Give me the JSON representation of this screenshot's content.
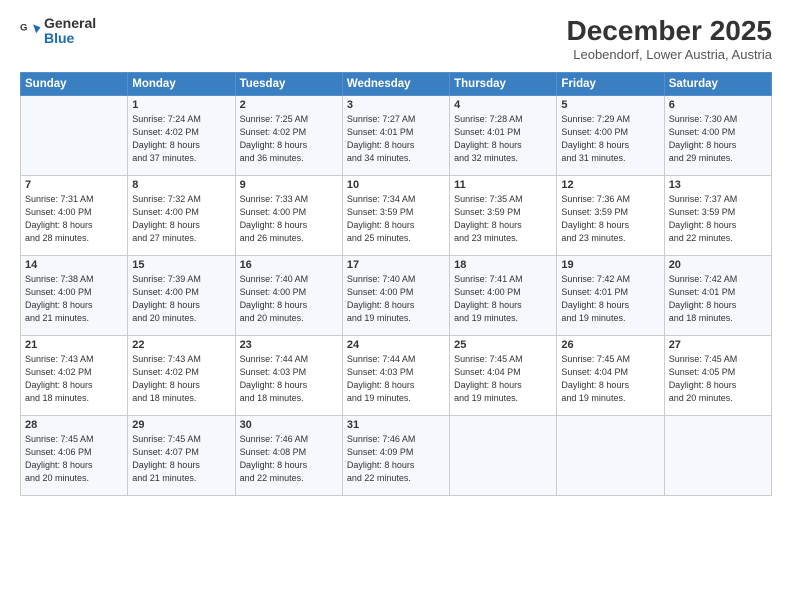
{
  "logo": {
    "line1": "General",
    "line2": "Blue"
  },
  "title": "December 2025",
  "location": "Leobendorf, Lower Austria, Austria",
  "days_of_week": [
    "Sunday",
    "Monday",
    "Tuesday",
    "Wednesday",
    "Thursday",
    "Friday",
    "Saturday"
  ],
  "weeks": [
    [
      {
        "num": "",
        "info": ""
      },
      {
        "num": "1",
        "info": "Sunrise: 7:24 AM\nSunset: 4:02 PM\nDaylight: 8 hours\nand 37 minutes."
      },
      {
        "num": "2",
        "info": "Sunrise: 7:25 AM\nSunset: 4:02 PM\nDaylight: 8 hours\nand 36 minutes."
      },
      {
        "num": "3",
        "info": "Sunrise: 7:27 AM\nSunset: 4:01 PM\nDaylight: 8 hours\nand 34 minutes."
      },
      {
        "num": "4",
        "info": "Sunrise: 7:28 AM\nSunset: 4:01 PM\nDaylight: 8 hours\nand 32 minutes."
      },
      {
        "num": "5",
        "info": "Sunrise: 7:29 AM\nSunset: 4:00 PM\nDaylight: 8 hours\nand 31 minutes."
      },
      {
        "num": "6",
        "info": "Sunrise: 7:30 AM\nSunset: 4:00 PM\nDaylight: 8 hours\nand 29 minutes."
      }
    ],
    [
      {
        "num": "7",
        "info": "Sunrise: 7:31 AM\nSunset: 4:00 PM\nDaylight: 8 hours\nand 28 minutes."
      },
      {
        "num": "8",
        "info": "Sunrise: 7:32 AM\nSunset: 4:00 PM\nDaylight: 8 hours\nand 27 minutes."
      },
      {
        "num": "9",
        "info": "Sunrise: 7:33 AM\nSunset: 4:00 PM\nDaylight: 8 hours\nand 26 minutes."
      },
      {
        "num": "10",
        "info": "Sunrise: 7:34 AM\nSunset: 3:59 PM\nDaylight: 8 hours\nand 25 minutes."
      },
      {
        "num": "11",
        "info": "Sunrise: 7:35 AM\nSunset: 3:59 PM\nDaylight: 8 hours\nand 23 minutes."
      },
      {
        "num": "12",
        "info": "Sunrise: 7:36 AM\nSunset: 3:59 PM\nDaylight: 8 hours\nand 23 minutes."
      },
      {
        "num": "13",
        "info": "Sunrise: 7:37 AM\nSunset: 3:59 PM\nDaylight: 8 hours\nand 22 minutes."
      }
    ],
    [
      {
        "num": "14",
        "info": "Sunrise: 7:38 AM\nSunset: 4:00 PM\nDaylight: 8 hours\nand 21 minutes."
      },
      {
        "num": "15",
        "info": "Sunrise: 7:39 AM\nSunset: 4:00 PM\nDaylight: 8 hours\nand 20 minutes."
      },
      {
        "num": "16",
        "info": "Sunrise: 7:40 AM\nSunset: 4:00 PM\nDaylight: 8 hours\nand 20 minutes."
      },
      {
        "num": "17",
        "info": "Sunrise: 7:40 AM\nSunset: 4:00 PM\nDaylight: 8 hours\nand 19 minutes."
      },
      {
        "num": "18",
        "info": "Sunrise: 7:41 AM\nSunset: 4:00 PM\nDaylight: 8 hours\nand 19 minutes."
      },
      {
        "num": "19",
        "info": "Sunrise: 7:42 AM\nSunset: 4:01 PM\nDaylight: 8 hours\nand 19 minutes."
      },
      {
        "num": "20",
        "info": "Sunrise: 7:42 AM\nSunset: 4:01 PM\nDaylight: 8 hours\nand 18 minutes."
      }
    ],
    [
      {
        "num": "21",
        "info": "Sunrise: 7:43 AM\nSunset: 4:02 PM\nDaylight: 8 hours\nand 18 minutes."
      },
      {
        "num": "22",
        "info": "Sunrise: 7:43 AM\nSunset: 4:02 PM\nDaylight: 8 hours\nand 18 minutes."
      },
      {
        "num": "23",
        "info": "Sunrise: 7:44 AM\nSunset: 4:03 PM\nDaylight: 8 hours\nand 18 minutes."
      },
      {
        "num": "24",
        "info": "Sunrise: 7:44 AM\nSunset: 4:03 PM\nDaylight: 8 hours\nand 19 minutes."
      },
      {
        "num": "25",
        "info": "Sunrise: 7:45 AM\nSunset: 4:04 PM\nDaylight: 8 hours\nand 19 minutes."
      },
      {
        "num": "26",
        "info": "Sunrise: 7:45 AM\nSunset: 4:04 PM\nDaylight: 8 hours\nand 19 minutes."
      },
      {
        "num": "27",
        "info": "Sunrise: 7:45 AM\nSunset: 4:05 PM\nDaylight: 8 hours\nand 20 minutes."
      }
    ],
    [
      {
        "num": "28",
        "info": "Sunrise: 7:45 AM\nSunset: 4:06 PM\nDaylight: 8 hours\nand 20 minutes."
      },
      {
        "num": "29",
        "info": "Sunrise: 7:45 AM\nSunset: 4:07 PM\nDaylight: 8 hours\nand 21 minutes."
      },
      {
        "num": "30",
        "info": "Sunrise: 7:46 AM\nSunset: 4:08 PM\nDaylight: 8 hours\nand 22 minutes."
      },
      {
        "num": "31",
        "info": "Sunrise: 7:46 AM\nSunset: 4:09 PM\nDaylight: 8 hours\nand 22 minutes."
      },
      {
        "num": "",
        "info": ""
      },
      {
        "num": "",
        "info": ""
      },
      {
        "num": "",
        "info": ""
      }
    ]
  ]
}
